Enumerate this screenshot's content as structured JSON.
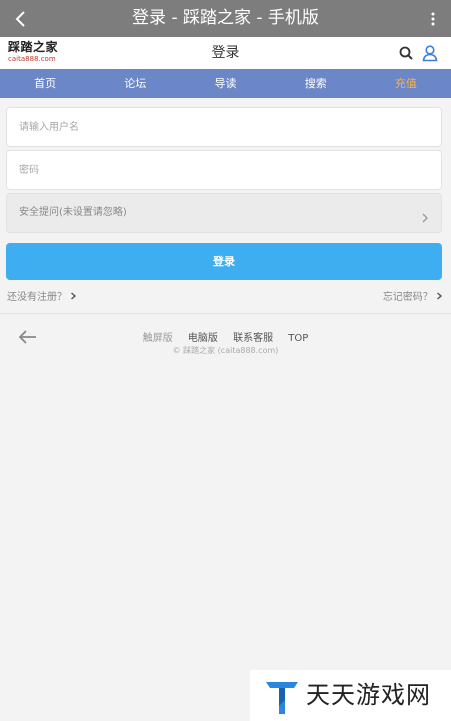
{
  "titlebar": {
    "title": "登录 - 踩踏之家 - 手机版"
  },
  "header": {
    "logo_name": "踩踏之家",
    "logo_domain": "caita888.com",
    "page_title": "登录"
  },
  "nav": {
    "items": [
      {
        "label": "首页"
      },
      {
        "label": "论坛"
      },
      {
        "label": "导读"
      },
      {
        "label": "搜索"
      },
      {
        "label": "充值"
      }
    ]
  },
  "form": {
    "username_placeholder": "请输入用户名",
    "password_placeholder": "密码",
    "security_question_label": "安全提问(未设置请忽略)",
    "login_label": "登录",
    "register_link": "还没有注册？",
    "forgot_link": "忘记密码？"
  },
  "footer": {
    "links": [
      {
        "label": "触屏版"
      },
      {
        "label": "电脑版"
      },
      {
        "label": "联系客服"
      },
      {
        "label": "TOP"
      }
    ],
    "copyright": "© 踩踏之家 (caita888.com)"
  },
  "watermark": {
    "text": "天天游戏网"
  },
  "colors": {
    "titlebar_bg": "#7d7d7d",
    "nav_bg": "#6c87c7",
    "nav_highlight": "#f6b24a",
    "primary_button": "#3faef0",
    "user_icon": "#3b7fd9"
  }
}
